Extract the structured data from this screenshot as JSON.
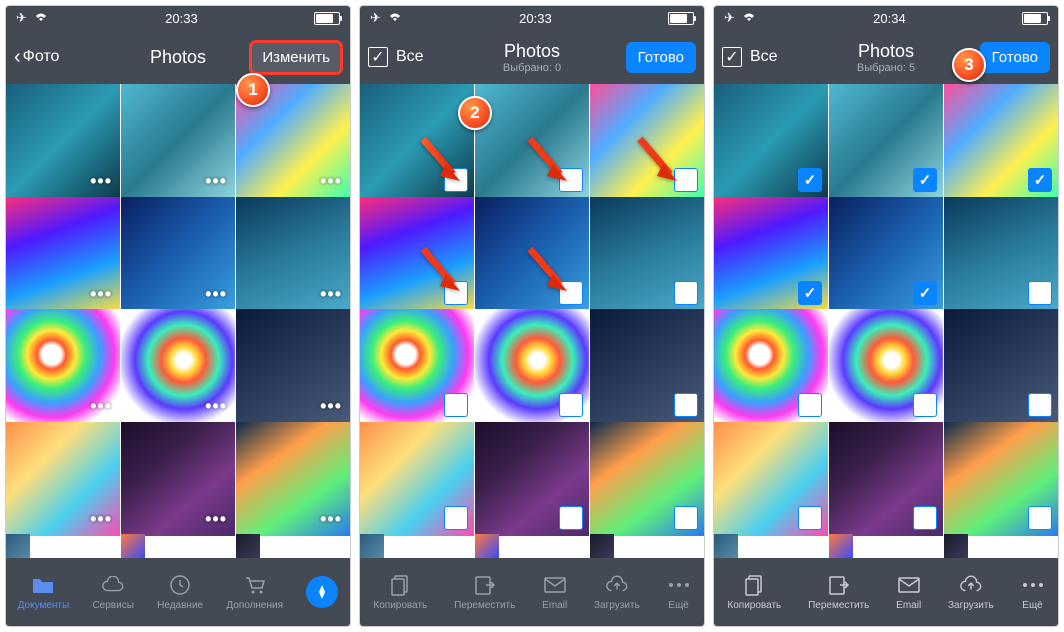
{
  "panel1": {
    "status_time": "20:33",
    "back_label": "Фото",
    "title": "Photos",
    "edit_label": "Изменить",
    "badge": "1",
    "toolbar": [
      {
        "label": "Документы",
        "icon": "folder"
      },
      {
        "label": "Сервисы",
        "icon": "cloud"
      },
      {
        "label": "Недавние",
        "icon": "clock"
      },
      {
        "label": "Дополнения",
        "icon": "cart"
      },
      {
        "label": "",
        "icon": "compass"
      }
    ]
  },
  "panel2": {
    "status_time": "20:33",
    "select_all_label": "Все",
    "title": "Photos",
    "subtitle": "Выбрано: 0",
    "done_label": "Готово",
    "badge": "2",
    "toolbar": [
      {
        "label": "Копировать",
        "icon": "copy"
      },
      {
        "label": "Переместить",
        "icon": "move"
      },
      {
        "label": "Email",
        "icon": "mail"
      },
      {
        "label": "Загрузить",
        "icon": "upload"
      },
      {
        "label": "Ещё",
        "icon": "more"
      }
    ]
  },
  "panel3": {
    "status_time": "20:34",
    "select_all_label": "Все",
    "title": "Photos",
    "subtitle": "Выбрано: 5",
    "done_label": "Готово",
    "badge": "3",
    "toolbar": [
      {
        "label": "Копировать",
        "icon": "copy"
      },
      {
        "label": "Переместить",
        "icon": "move"
      },
      {
        "label": "Email",
        "icon": "mail"
      },
      {
        "label": "Загрузить",
        "icon": "upload"
      },
      {
        "label": "Ещё",
        "icon": "more"
      }
    ],
    "selected_cells": [
      0,
      1,
      2,
      3,
      4
    ]
  },
  "wallpapers": [
    "w1",
    "w2",
    "w3",
    "w4",
    "w5",
    "w6",
    "w7",
    "w8",
    "w9",
    "w10",
    "w11",
    "w12",
    "w13",
    "w14",
    "w15"
  ]
}
